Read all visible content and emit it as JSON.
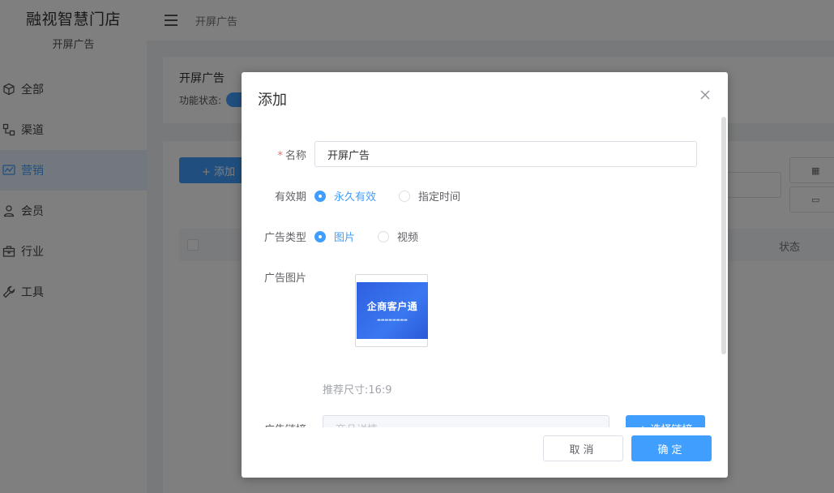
{
  "brand": {
    "title": "融视智慧门店",
    "subtitle": "开屏广告"
  },
  "sidebar": {
    "items": [
      {
        "label": "全部",
        "icon": "cube-icon",
        "active": false
      },
      {
        "label": "渠道",
        "icon": "channel-icon",
        "active": false
      },
      {
        "label": "营销",
        "icon": "chart-icon",
        "active": true
      },
      {
        "label": "会员",
        "icon": "user-icon",
        "active": false
      },
      {
        "label": "行业",
        "icon": "briefcase-icon",
        "active": false
      },
      {
        "label": "工具",
        "icon": "wrench-icon",
        "active": false
      }
    ]
  },
  "header": {
    "breadcrumb": "开屏广告"
  },
  "page": {
    "card_title": "开屏广告",
    "status_label": "功能状态:",
    "add_button": "+ 添加",
    "table_status_header": "状态"
  },
  "dialog": {
    "title": "添加",
    "name_label": "名称",
    "name_value": "开屏广告",
    "validity_label": "有效期",
    "validity_options": [
      "永久有效",
      "指定时间"
    ],
    "ad_type_label": "广告类型",
    "ad_type_options": [
      "图片",
      "视频"
    ],
    "ad_image_label": "广告图片",
    "image_text": "企商客户通",
    "hint": "推荐尺寸:16:9",
    "link_label": "广告链接",
    "link_placeholder": "商品详情",
    "choose_link_button": "+ 选择链接",
    "cancel_button": "取消",
    "confirm_button": "确定"
  },
  "colors": {
    "primary": "#409eff",
    "required": "#f56c6c"
  }
}
